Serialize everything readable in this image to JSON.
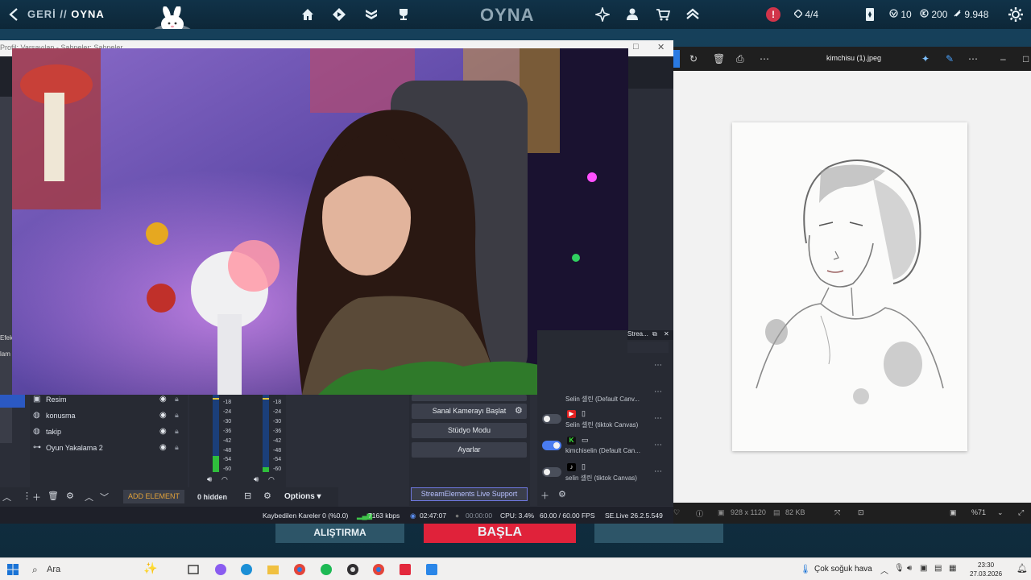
{
  "game": {
    "back_label": "GERİ //",
    "section_label": "OYNA",
    "title": "OYNA",
    "stats": {
      "slots": "4/4",
      "currency_a": "10",
      "currency_b": "200",
      "currency_c": "9.948"
    },
    "buttons": {
      "practice": "ALIŞTIRMA",
      "start": "BAŞLA"
    }
  },
  "obs": {
    "titlebar_text": "Profil: Varsayılan - Sahneler: Sahneler",
    "sources": [
      {
        "icon": "image-icon",
        "name": "Resim"
      },
      {
        "icon": "globe-icon",
        "name": "konusma"
      },
      {
        "icon": "globe-icon",
        "name": "takip"
      },
      {
        "icon": "gamepad-icon",
        "name": "Oyun Yakalama 2"
      }
    ],
    "toolbar": {
      "add_element": "ADD ELEMENT",
      "hidden": "0 hidden",
      "options": "Options"
    },
    "db_scale": [
      "-18",
      "-24",
      "-30",
      "-36",
      "-42",
      "-48",
      "-54",
      "-60"
    ],
    "controls": {
      "virtual_camera": "Sanal Kamerayı Başlat",
      "studio_mode": "Stüdyo Modu",
      "settings": "Ayarlar",
      "streamelements_support": "StreamElements Live Support"
    },
    "multistream": {
      "header": "Strea...",
      "targets": [
        {
          "platform": "",
          "device": "",
          "on": false,
          "text": "Selin 셀린 (Default Canv..."
        },
        {
          "platform": "youtube",
          "device": "phone",
          "on": false,
          "text": "Selin 셀린 (tiktok Canvas)"
        },
        {
          "platform": "kick",
          "device": "monitor",
          "on": true,
          "text": "kimchiselin (Default Can..."
        },
        {
          "platform": "tiktok",
          "device": "phone",
          "on": false,
          "text": "selin 셀린 (tiktok Canvas)"
        }
      ]
    },
    "status": {
      "dropped_frames": "Kaybedilen Kareler 0 (%0.0)",
      "bitrate": "7163 kbps",
      "stream_time": "02:47:07",
      "record_time": "00:00:00",
      "cpu": "CPU: 3.4%",
      "fps": "60.00 / 60.00 FPS",
      "version": "SE.Live 26.2.5.549"
    },
    "left_strip": [
      "Efek",
      "lam"
    ]
  },
  "photos": {
    "filename": "kimchisu (1).jpeg",
    "dimensions": "928 x 1120",
    "size": "82 KB",
    "zoom": "%71"
  },
  "taskbar": {
    "search": "Ara",
    "weather": "Çok soğuk hava",
    "time": "23:30",
    "date": "27.03.2026"
  }
}
